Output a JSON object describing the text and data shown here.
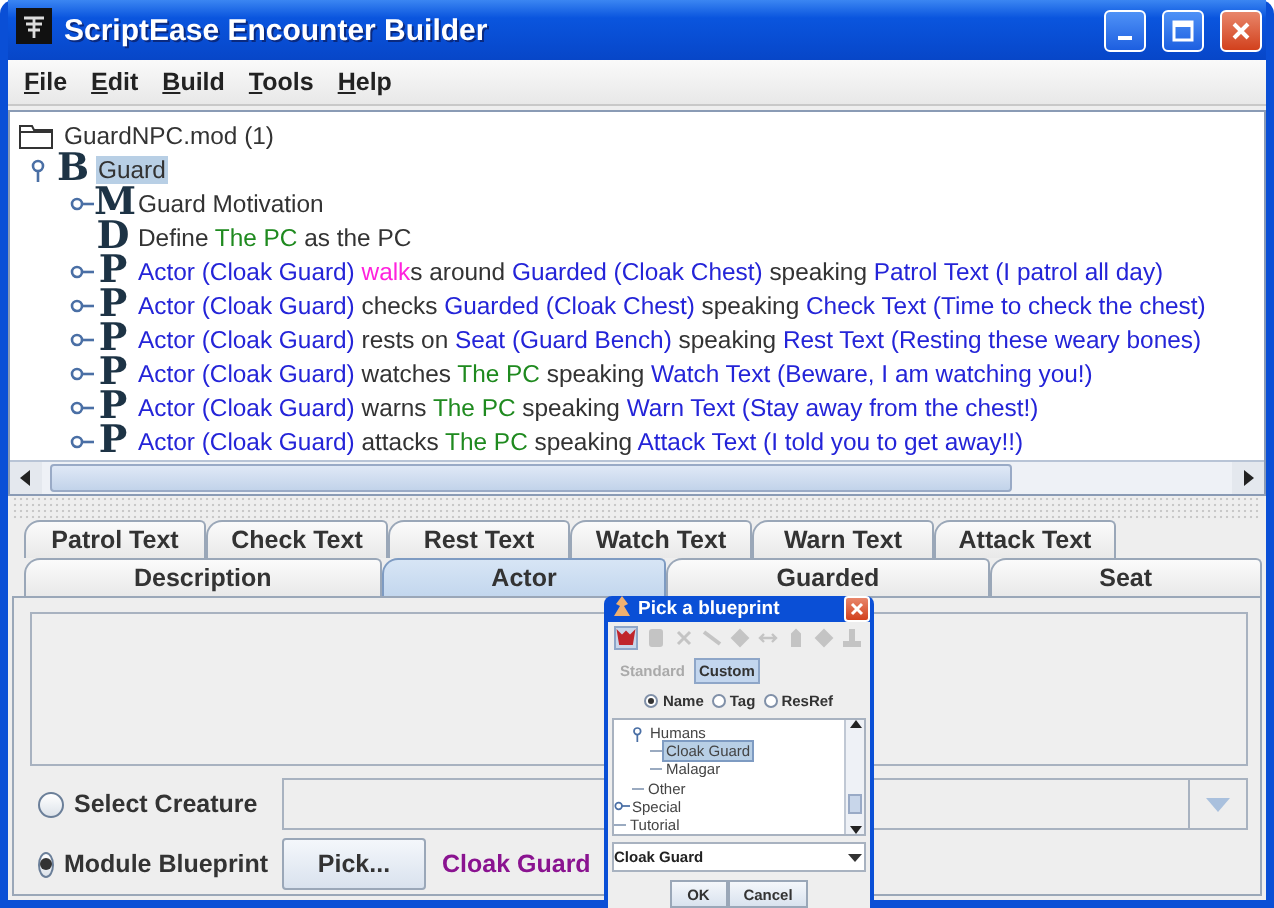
{
  "window": {
    "title": "ScriptEase Encounter Builder"
  },
  "menu": [
    {
      "mnemonic": "F",
      "rest": "ile"
    },
    {
      "mnemonic": "E",
      "rest": "dit"
    },
    {
      "mnemonic": "B",
      "rest": "uild"
    },
    {
      "mnemonic": "T",
      "rest": "ools"
    },
    {
      "mnemonic": "H",
      "rest": "elp"
    }
  ],
  "tree": {
    "items": [
      {
        "kind": "root",
        "label": "GuardNPC.mod (1)",
        "selected": false,
        "children": [
          {
            "kind": "node",
            "letter": "B",
            "selected": true,
            "expanded": true,
            "segments": [
              {
                "kind": "plain",
                "text": "Guard"
              }
            ],
            "children": [
              {
                "kind": "node",
                "letter": "M",
                "selected": false,
                "expanded": false,
                "segments": [
                  {
                    "kind": "plain",
                    "text": "Guard Motivation"
                  }
                ]
              },
              {
                "kind": "leaf",
                "letter": "D",
                "selected": false,
                "segments": [
                  {
                    "kind": "plain",
                    "text": "Define "
                  },
                  {
                    "kind": "param",
                    "text": "The PC"
                  },
                  {
                    "kind": "plain",
                    "text": " as the PC"
                  }
                ]
              },
              {
                "kind": "node",
                "letter": "P",
                "selected": false,
                "expanded": false,
                "segments": [
                  {
                    "kind": "actor",
                    "text": "Actor (Cloak Guard) "
                  },
                  {
                    "kind": "verb",
                    "text": "walk"
                  },
                  {
                    "kind": "plain",
                    "text": "s around "
                  },
                  {
                    "kind": "actor",
                    "text": "Guarded (Cloak Chest)"
                  },
                  {
                    "kind": "plain",
                    "text": " speaking "
                  },
                  {
                    "kind": "actor",
                    "text": "Patrol Text (I patrol all day)"
                  }
                ]
              },
              {
                "kind": "node",
                "letter": "P",
                "selected": false,
                "expanded": false,
                "segments": [
                  {
                    "kind": "actor",
                    "text": "Actor (Cloak Guard)"
                  },
                  {
                    "kind": "plain",
                    "text": " checks "
                  },
                  {
                    "kind": "actor",
                    "text": "Guarded (Cloak Chest)"
                  },
                  {
                    "kind": "plain",
                    "text": " speaking "
                  },
                  {
                    "kind": "actor",
                    "text": "Check Text (Time to check the chest)"
                  }
                ]
              },
              {
                "kind": "node",
                "letter": "P",
                "selected": false,
                "expanded": false,
                "segments": [
                  {
                    "kind": "actor",
                    "text": "Actor (Cloak Guard)"
                  },
                  {
                    "kind": "plain",
                    "text": " rests on "
                  },
                  {
                    "kind": "actor",
                    "text": "Seat (Guard Bench)"
                  },
                  {
                    "kind": "plain",
                    "text": " speaking "
                  },
                  {
                    "kind": "actor",
                    "text": "Rest Text (Resting these weary bones)"
                  }
                ]
              },
              {
                "kind": "node",
                "letter": "P",
                "selected": false,
                "expanded": false,
                "segments": [
                  {
                    "kind": "actor",
                    "text": "Actor (Cloak Guard)"
                  },
                  {
                    "kind": "plain",
                    "text": " watches "
                  },
                  {
                    "kind": "param",
                    "text": "The PC"
                  },
                  {
                    "kind": "plain",
                    "text": " speaking "
                  },
                  {
                    "kind": "actor",
                    "text": "Watch Text (Beware, I am watching you!)"
                  }
                ]
              },
              {
                "kind": "node",
                "letter": "P",
                "selected": false,
                "expanded": false,
                "segments": [
                  {
                    "kind": "actor",
                    "text": "Actor (Cloak Guard)"
                  },
                  {
                    "kind": "plain",
                    "text": " warns "
                  },
                  {
                    "kind": "param",
                    "text": "The PC"
                  },
                  {
                    "kind": "plain",
                    "text": " speaking "
                  },
                  {
                    "kind": "actor",
                    "text": "Warn Text (Stay away from the chest!)"
                  }
                ]
              },
              {
                "kind": "node",
                "letter": "P",
                "selected": false,
                "expanded": false,
                "segments": [
                  {
                    "kind": "actor",
                    "text": "Actor (Cloak Guard)"
                  },
                  {
                    "kind": "plain",
                    "text": " attacks "
                  },
                  {
                    "kind": "param",
                    "text": "The PC"
                  },
                  {
                    "kind": "plain",
                    "text": " speaking "
                  },
                  {
                    "kind": "actor",
                    "text": "Attack Text (I told you to get away!!)"
                  }
                ]
              }
            ]
          }
        ]
      }
    ]
  },
  "tabs": {
    "rows": [
      {
        "tabs": [
          {
            "label": "Patrol Text",
            "selected": false
          },
          {
            "label": "Check Text",
            "selected": false
          },
          {
            "label": "Rest Text",
            "selected": false
          },
          {
            "label": "Watch Text",
            "selected": false
          },
          {
            "label": "Warn Text",
            "selected": false
          },
          {
            "label": "Attack Text",
            "selected": false
          }
        ]
      },
      {
        "tabs": [
          {
            "label": "Description",
            "selected": false
          },
          {
            "label": "Actor",
            "selected": true
          },
          {
            "label": "Guarded",
            "selected": false
          },
          {
            "label": "Seat",
            "selected": false
          }
        ]
      }
    ]
  },
  "source": [
    {
      "kind": "combo",
      "label": "Select Creature",
      "selected": false
    },
    {
      "kind": "pick",
      "label": "Module Blueprint",
      "selected": true,
      "button": "Pick...",
      "value": "Cloak Guard"
    }
  ],
  "dialog": {
    "title": "Pick a blueprint",
    "toolbar": [
      {
        "disabled": false
      },
      {
        "disabled": true
      },
      {
        "disabled": true
      },
      {
        "disabled": true
      },
      {
        "disabled": true
      },
      {
        "disabled": true
      },
      {
        "disabled": true
      },
      {
        "disabled": true
      },
      {
        "disabled": true
      }
    ],
    "modes": [
      {
        "label": "Standard",
        "selected": false
      },
      {
        "label": "Custom",
        "selected": true
      }
    ],
    "search_by": [
      {
        "label": "Name",
        "selected": true
      },
      {
        "label": "Tag",
        "selected": false
      },
      {
        "label": "ResRef",
        "selected": false
      }
    ],
    "tree": [
      {
        "kind": "scrolled",
        "children": [
          {
            "kind": "node",
            "label": "Humans",
            "selected": false,
            "expanded": true,
            "children": [
              {
                "kind": "leaf",
                "label": "Cloak Guard",
                "selected": true
              },
              {
                "kind": "leaf",
                "label": "Malagar",
                "selected": false
              }
            ]
          },
          {
            "kind": "leaf",
            "label": "Other",
            "selected": false
          }
        ]
      },
      {
        "kind": "node",
        "label": "Special",
        "selected": false,
        "expanded": false
      },
      {
        "kind": "leaf",
        "label": "Tutorial",
        "selected": false
      }
    ],
    "combo": {
      "value": "Cloak Guard"
    },
    "buttons": [
      "OK",
      "Cancel"
    ]
  }
}
